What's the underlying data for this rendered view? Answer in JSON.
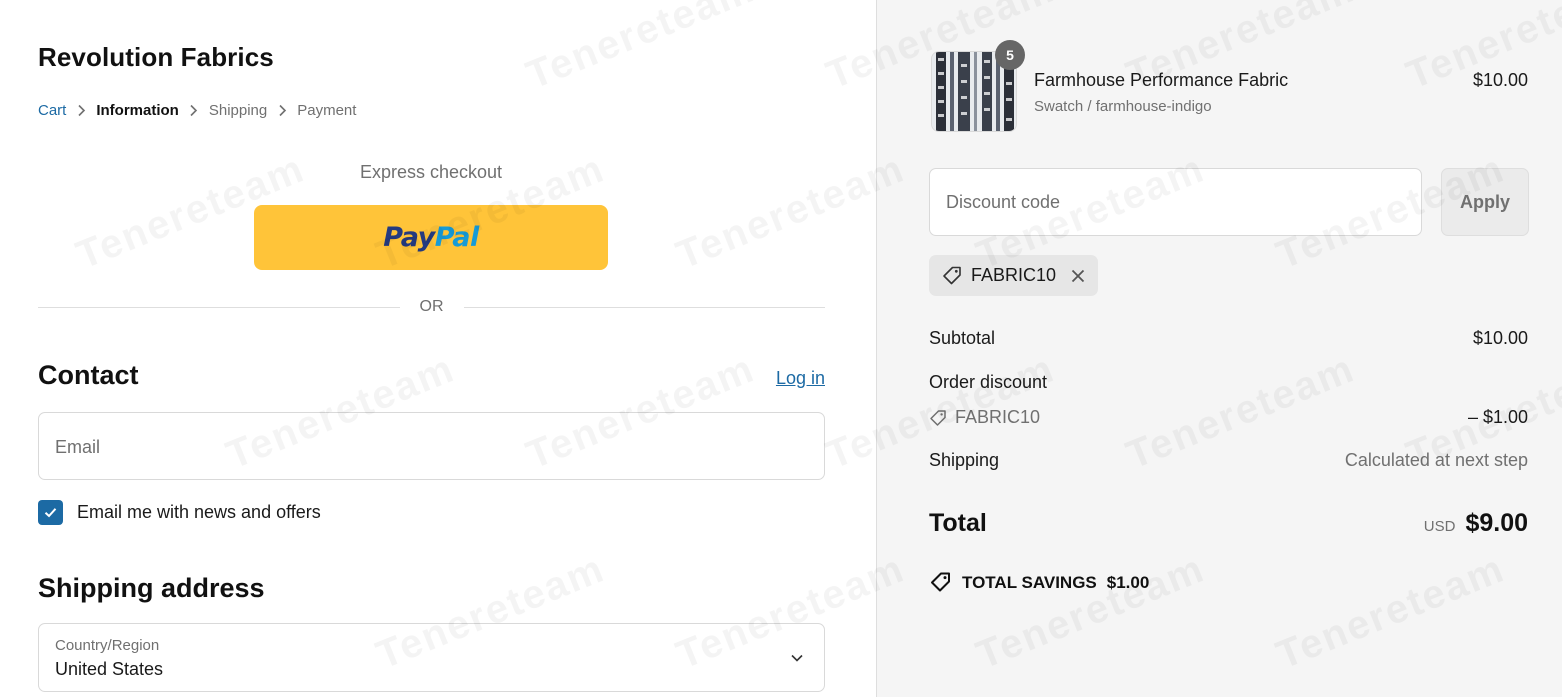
{
  "store": {
    "name": "Revolution Fabrics"
  },
  "breadcrumb": [
    {
      "label": "Cart",
      "state": "link"
    },
    {
      "label": "Information",
      "state": "current"
    },
    {
      "label": "Shipping",
      "state": "upcoming"
    },
    {
      "label": "Payment",
      "state": "upcoming"
    }
  ],
  "express": {
    "title": "Express checkout",
    "paypal_pay": "Pay",
    "paypal_pal": "Pal",
    "divider": "OR"
  },
  "contact": {
    "title": "Contact",
    "login_label": "Log in",
    "email_placeholder": "Email",
    "newsletter_label": "Email me with news and offers",
    "newsletter_checked": true
  },
  "shipping_address": {
    "title": "Shipping address",
    "country_label": "Country/Region",
    "country_value": "United States"
  },
  "order": {
    "item": {
      "title": "Farmhouse Performance Fabric",
      "variant": "Swatch / farmhouse-indigo",
      "price": "$10.00",
      "quantity": "5"
    },
    "discount_placeholder": "Discount code",
    "apply_label": "Apply",
    "applied_code": "FABRIC10",
    "subtotal_label": "Subtotal",
    "subtotal_value": "$10.00",
    "order_discount_label": "Order discount",
    "discount_code": "FABRIC10",
    "discount_value": "– $1.00",
    "shipping_label": "Shipping",
    "shipping_value": "Calculated at next step",
    "total_label": "Total",
    "currency": "USD",
    "total_value": "$9.00",
    "savings_label": "TOTAL SAVINGS",
    "savings_value": "$1.00"
  },
  "watermark": {
    "text": "Tenereteam"
  },
  "colors": {
    "link": "#1c6aa4",
    "paypal": "#ffc439",
    "sidebar_bg": "#f5f5f5"
  }
}
